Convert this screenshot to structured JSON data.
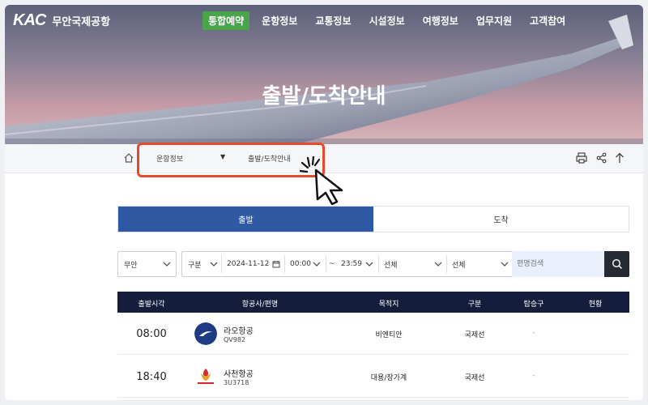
{
  "header": {
    "logo_text": "KAC",
    "airport_name": "무안국제공항",
    "nav": [
      {
        "label": "통합예약",
        "active": true
      },
      {
        "label": "운항정보"
      },
      {
        "label": "교통정보"
      },
      {
        "label": "시설정보"
      },
      {
        "label": "여행정보"
      },
      {
        "label": "업무지원"
      },
      {
        "label": "고객참여"
      }
    ]
  },
  "hero": {
    "title": "출발/도착안내"
  },
  "breadcrumb": {
    "home_icon": "home-icon",
    "section": "운항정보",
    "current": "출발/도착안내",
    "tools": [
      "print-icon",
      "share-icon",
      "arrow-up-icon"
    ]
  },
  "tabs": [
    {
      "label": "출발",
      "active": true
    },
    {
      "label": "도착"
    }
  ],
  "filters": {
    "airport": "무안",
    "type": "구분",
    "date": "2024-11-12",
    "time_from": "00:00",
    "range_sep": "~",
    "time_to": "23:59",
    "airline": "선체",
    "destination": "선체",
    "search_placeholder": "편명검색"
  },
  "table": {
    "headers": [
      "출발시각",
      "항공사/편명",
      "목적지",
      "구분",
      "탑승구",
      "현황"
    ],
    "rows": [
      {
        "time": "08:00",
        "airline": "라오항공",
        "flight": "QV982",
        "destination": "비엔티안",
        "type": "국제선",
        "gate": "-",
        "status": ""
      },
      {
        "time": "18:40",
        "airline": "사천항공",
        "flight": "3U3718",
        "destination": "대용/장가계",
        "type": "국제선",
        "gate": "-",
        "status": ""
      }
    ]
  },
  "colors": {
    "nav_active": "#4aa54a",
    "tab_active": "#2f5aa3",
    "table_header": "#141e3c",
    "highlight": "#e8492a"
  }
}
